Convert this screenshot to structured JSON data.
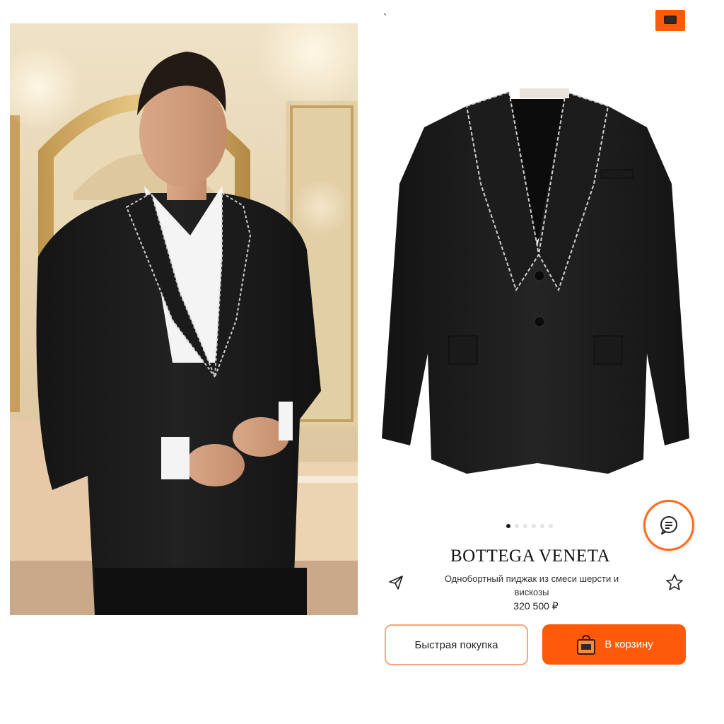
{
  "product": {
    "brand": "BOTTEGA VENETA",
    "description": "Однобортный пиджак из смеси шерсти и вискозы",
    "price": "320 500 ₽"
  },
  "gallery": {
    "slide_count": 6,
    "active_index": 0
  },
  "actions": {
    "quick_buy_label": "Быстрая покупка",
    "add_to_cart_label": "В корзину"
  },
  "icons": {
    "share": "paper-plane-icon",
    "favorite": "star-icon",
    "chat": "chat-bubble-icon",
    "cart": "shopping-bag-icon"
  },
  "colors": {
    "accent": "#ff5a0a",
    "accent_border": "#f5a77c",
    "text": "#222222"
  }
}
